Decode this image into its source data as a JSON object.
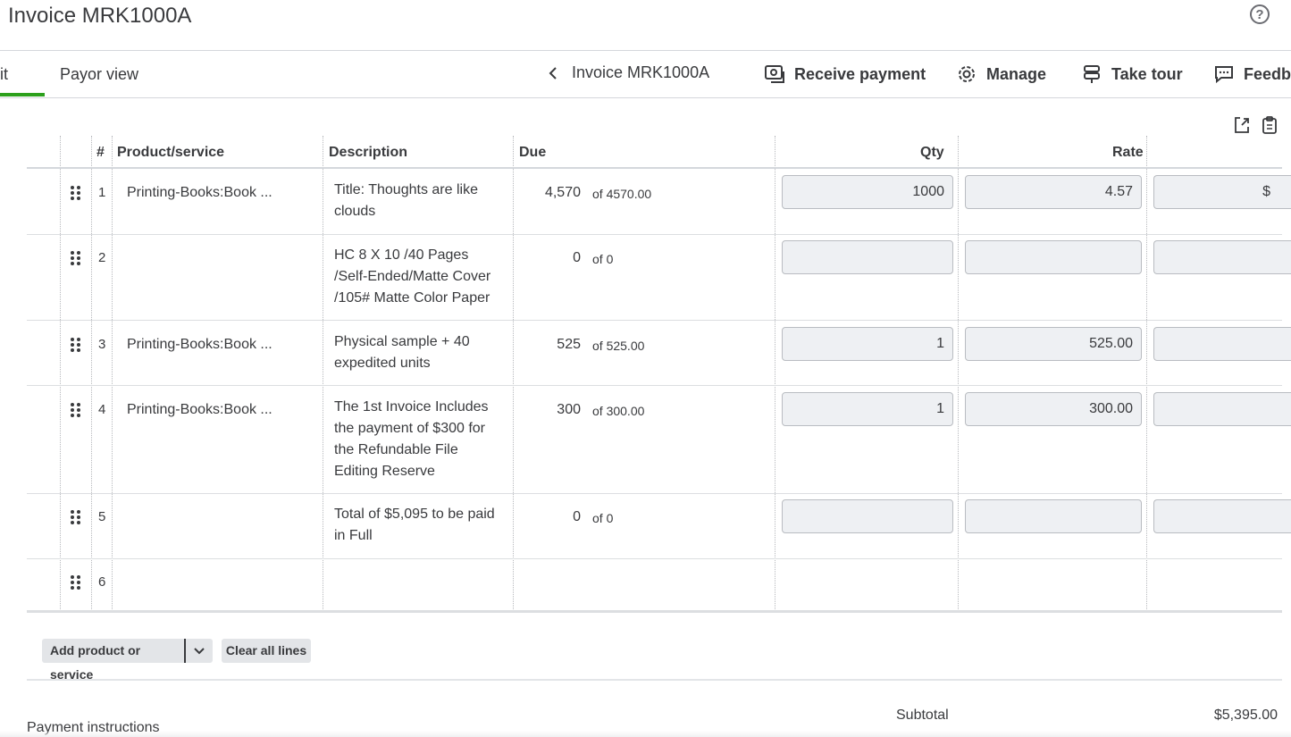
{
  "header": {
    "title": "Invoice MRK1000A"
  },
  "tabs": {
    "edit_partial": "it",
    "payor_view": "Payor view"
  },
  "toolbar": {
    "invoice_label": "Invoice MRK1000A",
    "receive_payment": "Receive payment",
    "manage": "Manage",
    "take_tour": "Take tour",
    "feedback_partial": "Feedb"
  },
  "table": {
    "headers": {
      "num": "#",
      "product": "Product/service",
      "description": "Description",
      "due": "Due",
      "qty": "Qty",
      "rate": "Rate"
    },
    "rows": [
      {
        "n": "1",
        "product": "Printing-Books:Book ...",
        "desc": [
          "Title: Thoughts are like",
          "clouds"
        ],
        "due": "4,570",
        "due_of": "of 4570.00",
        "qty": "1000",
        "rate": "4.57",
        "amount": "$"
      },
      {
        "n": "2",
        "product": "",
        "desc": [
          "HC 8  X  10 /40 Pages",
          "/Self-Ended/Matte Cover",
          "/105#  Matte Color Paper"
        ],
        "due": "0",
        "due_of": "of 0",
        "qty": "",
        "rate": "",
        "amount": ""
      },
      {
        "n": "3",
        "product": "Printing-Books:Book ...",
        "desc": [
          "Physical sample + 40",
          "expedited units"
        ],
        "due": "525",
        "due_of": "of 525.00",
        "qty": "1",
        "rate": "525.00",
        "amount": ""
      },
      {
        "n": "4",
        "product": "Printing-Books:Book ...",
        "desc": [
          "The 1st Invoice Includes",
          "the payment of $300 for",
          "the Refundable File",
          "Editing Reserve"
        ],
        "due": "300",
        "due_of": "of 300.00",
        "qty": "1",
        "rate": "300.00",
        "amount": ""
      },
      {
        "n": "5",
        "product": "",
        "desc": [
          "Total of $5,095 to be paid",
          "in Full"
        ],
        "due": "0",
        "due_of": "of 0",
        "qty": "",
        "rate": "",
        "amount": ""
      },
      {
        "n": "6",
        "product": "",
        "desc": [],
        "due": "",
        "due_of": "",
        "qty": "",
        "rate": "",
        "amount": ""
      }
    ]
  },
  "actions": {
    "add_product": "Add product or service",
    "clear_lines": "Clear all lines"
  },
  "summary": {
    "subtotal_label": "Subtotal",
    "subtotal_value": "$5,395.00"
  },
  "footer": {
    "payment_instructions": "Payment instructions"
  },
  "colors": {
    "accent_green": "#2ca01c",
    "text": "#393a3d",
    "input_bg": "#eef0f3"
  }
}
